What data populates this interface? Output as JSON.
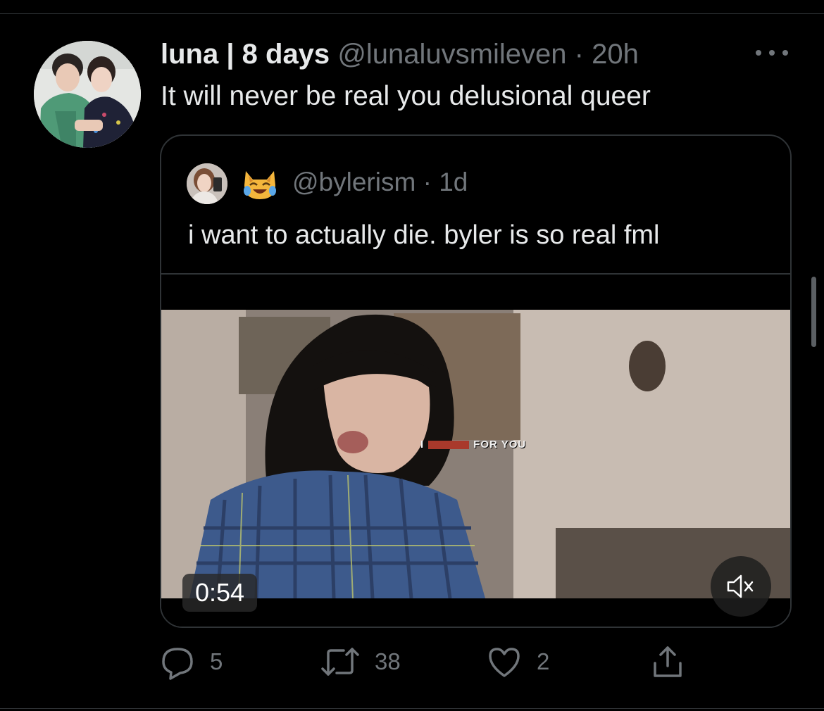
{
  "tweet": {
    "display_name": "luna | 8 days",
    "handle": "@lunaluvsmileven",
    "separator": "·",
    "time": "20h",
    "text": "It will never be real you delusional queer",
    "avatar_icon": "profile-photo-two-people",
    "more_icon": "more-horizontal-icon"
  },
  "quoted_tweet": {
    "handle": "@bylerism",
    "separator": "·",
    "time": "1d",
    "emoji_icon": "cat-face-with-tears-of-joy-emoji",
    "text": "i want to actually die. byler is so real fml",
    "video": {
      "duration": "0:54",
      "caption": "FOR YOU",
      "caption_prefix": "I",
      "mute_icon": "speaker-muted-icon"
    }
  },
  "actions": {
    "reply_count": "5",
    "retweet_count": "38",
    "like_count": "2",
    "reply_icon": "reply-bubble-icon",
    "retweet_icon": "retweet-icon",
    "like_icon": "heart-icon",
    "share_icon": "share-icon"
  },
  "colors": {
    "background": "#000000",
    "text_primary": "#e7e9ea",
    "text_secondary": "#71767b",
    "border": "#2f3336"
  }
}
